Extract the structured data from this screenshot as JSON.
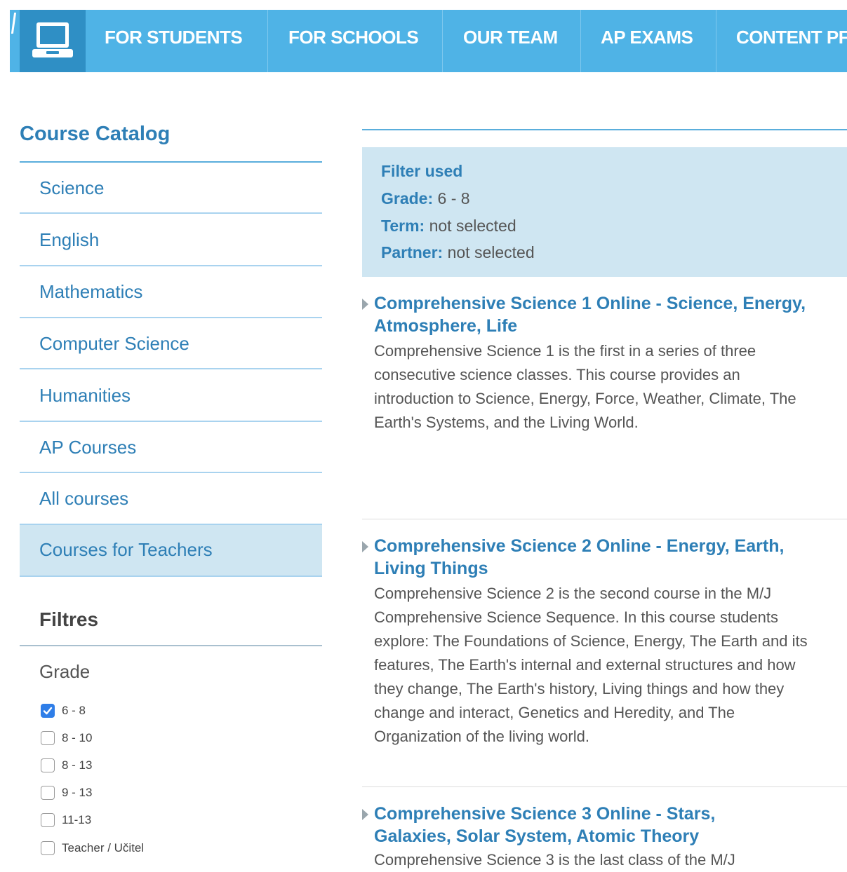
{
  "nav": {
    "items": [
      "FOR STUDENTS",
      "FOR SCHOOLS",
      "OUR TEAM",
      "AP EXAMS",
      "CONTENT PF"
    ],
    "colors": {
      "bar": "#4fb3e6",
      "logo_bg": "#2f8fc5"
    },
    "logo_icon": "laptop-icon"
  },
  "sidebar": {
    "catalog_title": "Course Catalog",
    "categories": [
      "Science",
      "English",
      "Mathematics",
      "Computer Science",
      "Humanities",
      "AP Courses",
      "All courses",
      "Courses for Teachers"
    ],
    "active_category": "Courses for Teachers",
    "filters_title": "Filtres",
    "grade_title": "Grade",
    "grades": [
      {
        "label": "6 - 8",
        "checked": true
      },
      {
        "label": "8 - 10",
        "checked": false
      },
      {
        "label": "8 - 13",
        "checked": false
      },
      {
        "label": "9 - 13",
        "checked": false
      },
      {
        "label": "11-13",
        "checked": false
      },
      {
        "label": "Teacher / Učitel",
        "checked": false
      }
    ]
  },
  "filter_summary": {
    "heading": "Filter used",
    "grade_key": "Grade:",
    "grade_value": " 6 - 8",
    "term_key": "Term:",
    "term_value": " not selected",
    "partner_key": "Partner:",
    "partner_value": " not selected"
  },
  "courses": [
    {
      "title": "Comprehensive Science 1 Online - Science, Energy, Atmosphere, Life",
      "description": "Comprehensive Science 1 is the first in a series of three consecutive science classes. This course provides an introduction to Science, Energy, Force, Weather, Climate, The Earth's Systems, and the Living World."
    },
    {
      "title": "Comprehensive Science 2 Online - Energy, Earth, Living Things",
      "description": "Comprehensive Science 2 is the second course in the M/J Comprehensive Science Sequence. In this course students explore: The Foundations of Science, Energy, The Earth and its features, The Earth's internal and external structures and how they change, The Earth's history, Living things and how they change and interact, Genetics and Heredity, and The Organization of the living world."
    },
    {
      "title": "Comprehensive Science 3 Online - Stars, Galaxies, Solar System, Atomic Theory",
      "description": "Comprehensive Science 3 is the last class of the M/J"
    }
  ]
}
